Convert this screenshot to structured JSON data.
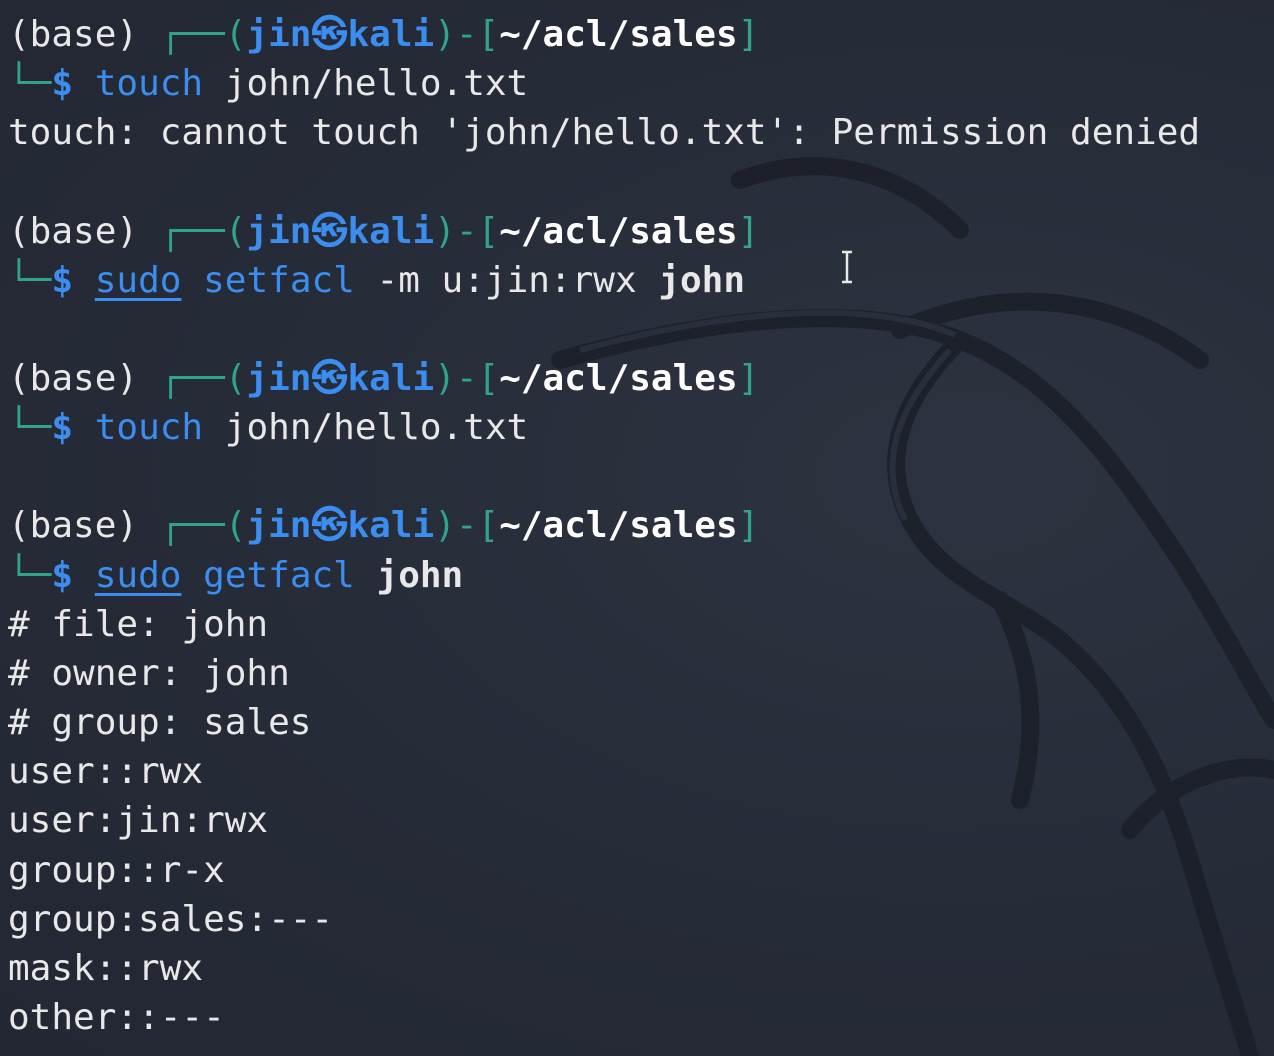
{
  "theme": {
    "background": "#262b38",
    "prompt_frame_color": "#2fa38c",
    "user_color": "#3b8ef0",
    "text_color": "#e8e8e8"
  },
  "prompt": {
    "env": "(base)",
    "frame_open": "┌──(",
    "user": "jin",
    "separator_icon": "kali-skull-icon",
    "separator": "㉿",
    "host": "kali",
    "frame_mid": ")-[",
    "path": "~/acl/sales",
    "frame_close": "]",
    "second_line_prefix": "└─",
    "dollar": "$"
  },
  "blocks": [
    {
      "command": {
        "name": "touch",
        "args": "john/hello.txt"
      },
      "output": [
        "touch: cannot touch 'john/hello.txt': Permission denied"
      ]
    },
    {
      "command": {
        "sudo": "sudo",
        "name": "setfacl",
        "flag": "-m u:jin:rwx",
        "target": "john"
      },
      "output": []
    },
    {
      "command": {
        "name": "touch",
        "args": "john/hello.txt"
      },
      "output": []
    },
    {
      "command": {
        "sudo": "sudo",
        "name": "getfacl",
        "target": "john"
      },
      "output": [
        "# file: john",
        "# owner: john",
        "# group: sales",
        "user::rwx",
        "user:jin:rwx",
        "group::r-x",
        "group:sales:---",
        "mask::rwx",
        "other::---"
      ]
    }
  ]
}
